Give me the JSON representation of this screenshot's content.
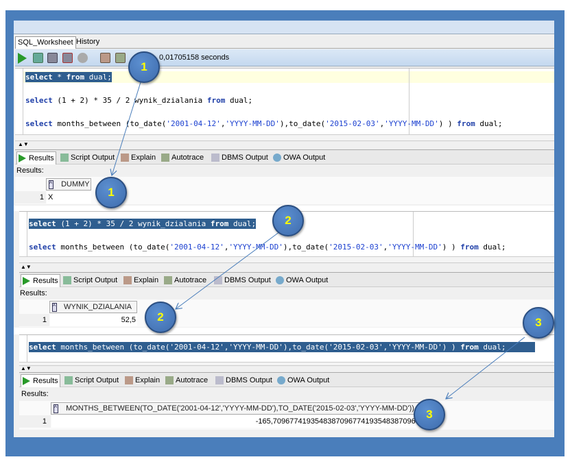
{
  "worksheet_tabs": [
    "SQL_Worksheet",
    "History"
  ],
  "toolbar": {
    "icons": [
      "run-statement-icon",
      "run-script-icon",
      "commit-icon",
      "rollback-icon",
      "cancel-icon",
      "explain-plan-icon",
      "autotrace-icon"
    ],
    "timing": "0,01705158 seconds"
  },
  "editor1": {
    "lines": [
      "select * from dual;",
      "select (1 + 2) * 35 / 2 wynik_dzialania from dual;",
      "select months_between (to_date('2001-04-12','YYYY-MM-DD'),to_date('2015-02-03','YYYY-MM-DD') ) from dual;"
    ]
  },
  "result_tabs": [
    "Results",
    "Script Output",
    "Explain",
    "Autotrace",
    "DBMS Output",
    "OWA Output"
  ],
  "results_label": "Results:",
  "result1": {
    "column": "DUMMY",
    "row_num": "1",
    "value": "X"
  },
  "editor2": {
    "lines": [
      "select (1 + 2) * 35 / 2 wynik_dzialania from dual;",
      "select months_between (to_date('2001-04-12','YYYY-MM-DD'),to_date('2015-02-03','YYYY-MM-DD') ) from dual;"
    ]
  },
  "result2": {
    "column": "WYNIK_DZIALANIA",
    "row_num": "1",
    "value": "52,5"
  },
  "editor3": {
    "lines": [
      "select months_between (to_date('2001-04-12','YYYY-MM-DD'),to_date('2015-02-03','YYYY-MM-DD') ) from dual;"
    ]
  },
  "result3": {
    "column": "MONTHS_BETWEEN(TO_DATE('2001-04-12','YYYY-MM-DD'),TO_DATE('2015-02-03','YYYY-MM-DD'))",
    "row_num": "1",
    "value": "-165,709677419354838709677419354838709677"
  },
  "callouts": [
    "1",
    "1",
    "2",
    "2",
    "3",
    "3"
  ],
  "colors": {
    "frame": "#4a7ebb",
    "selection": "#2f5e8f",
    "callout": "#4a7ebb",
    "callout_text": "#ffff00"
  }
}
